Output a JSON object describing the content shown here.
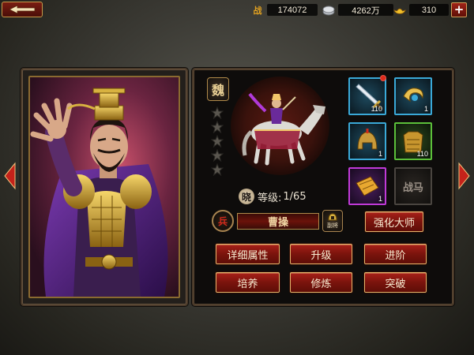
{
  "topbar": {
    "power_icon_label": "战",
    "power_value": "174072",
    "silver_value": "4262万",
    "gold_value": "310",
    "add_label": "+"
  },
  "hero": {
    "faction": "魏",
    "stars": 5,
    "level_badge": "晓",
    "level_label": "等级:",
    "level_value": "1/65",
    "soldier_type": "兵",
    "name": "曹操",
    "swap_label": "副将"
  },
  "equipment": [
    {
      "name": "sword",
      "count": "110",
      "quality": "blue"
    },
    {
      "name": "amulet",
      "count": "1",
      "quality": "blue"
    },
    {
      "name": "helmet",
      "count": "1",
      "quality": "blue"
    },
    {
      "name": "armor",
      "count": "110",
      "quality": "green"
    },
    {
      "name": "book",
      "count": "1",
      "quality": "purple"
    },
    {
      "name": "mount-slot",
      "label": "战马",
      "quality": "empty"
    }
  ],
  "buttons": {
    "master": "强化大师",
    "details": "详细属性",
    "upgrade": "升级",
    "advance": "进阶",
    "train": "培养",
    "cultivate": "修炼",
    "breakthrough": "突破"
  },
  "colors": {
    "button_red": "#a82018",
    "frame_gold": "#e4b56a",
    "quality_blue": "#3aa9d8",
    "quality_green": "#5cc03a",
    "quality_purple": "#c03ad8"
  }
}
